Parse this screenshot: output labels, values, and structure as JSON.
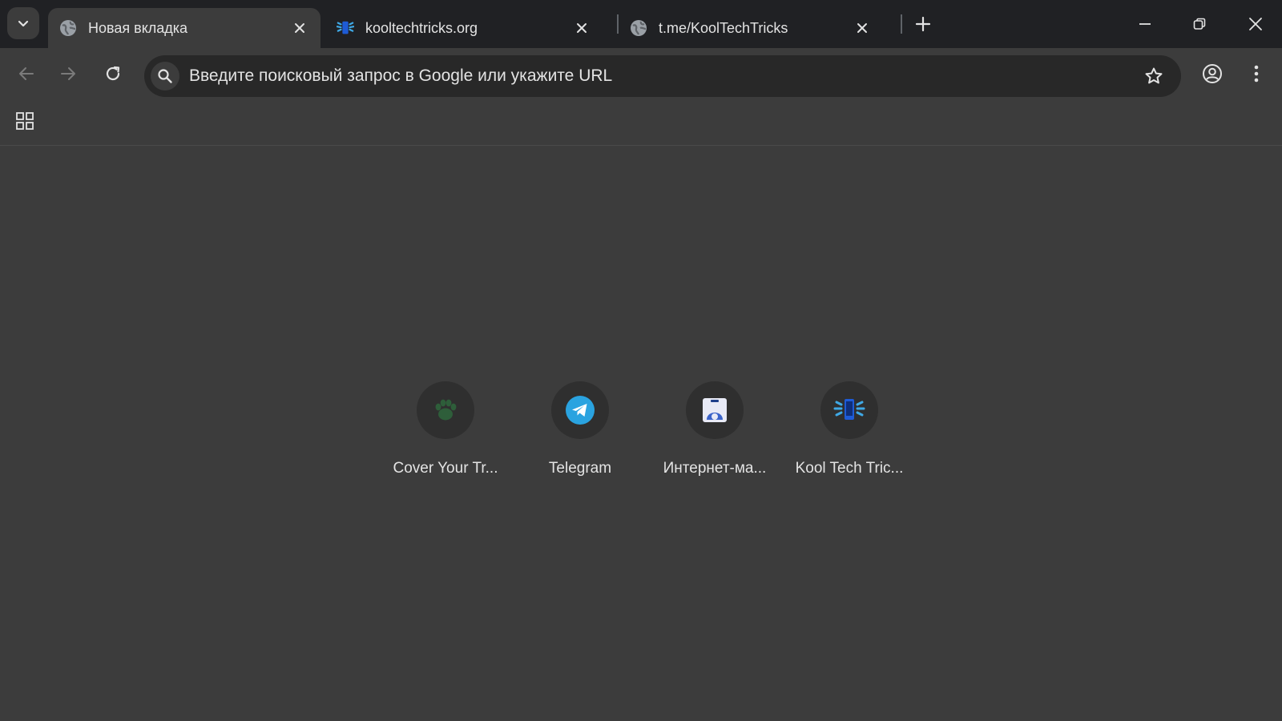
{
  "tabs": [
    {
      "title": "Новая вкладка",
      "icon": "globe-icon",
      "active": true
    },
    {
      "title": "kooltechtricks.org",
      "icon": "kooltechtricks-favicon",
      "active": false
    },
    {
      "title": "t.me/KoolTechTricks",
      "icon": "globe-icon",
      "active": false
    }
  ],
  "omnibox": {
    "placeholder": "Введите поисковый запрос в Google или укажите URL"
  },
  "shortcuts": [
    {
      "label": "Cover Your Tr...",
      "icon": "paw-icon"
    },
    {
      "label": "Telegram",
      "icon": "telegram-icon"
    },
    {
      "label": "Интернет-ма...",
      "icon": "store-icon"
    },
    {
      "label": "Kool Tech Tric...",
      "icon": "kooltechtricks-icon"
    }
  ],
  "colors": {
    "tabstrip_bg": "#202124",
    "toolbar_bg": "#3c3c3c",
    "omnibox_bg": "#282828",
    "page_bg": "#3c3c3c",
    "text": "#e3e3e3",
    "telegram_blue": "#2aa3e0"
  }
}
